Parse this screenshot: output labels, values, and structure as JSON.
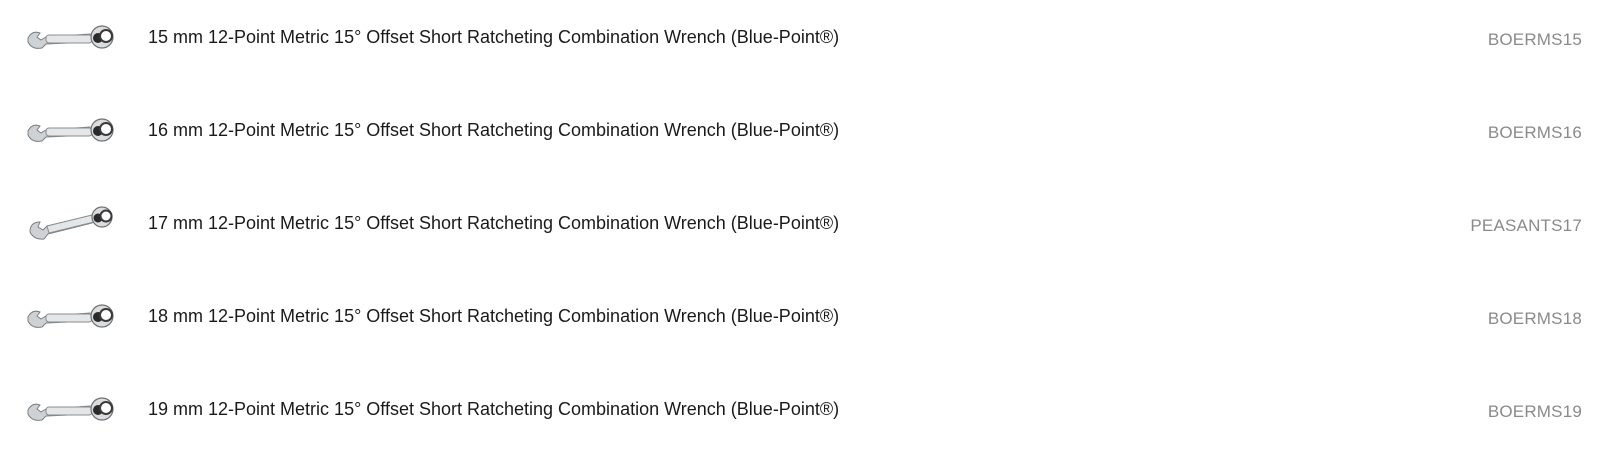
{
  "products": [
    {
      "title": "15 mm 12-Point Metric 15° Offset Short Ratcheting Combination Wrench (Blue-Point®)",
      "sku": "BOERMS15",
      "icon": "ratcheting-wrench-icon"
    },
    {
      "title": "16 mm 12-Point Metric 15° Offset Short Ratcheting Combination Wrench (Blue-Point®)",
      "sku": "BOERMS16",
      "icon": "ratcheting-wrench-icon"
    },
    {
      "title": "17 mm 12-Point Metric 15° Offset Short Ratcheting Combination Wrench (Blue-Point®)",
      "sku": "PEASANTS17",
      "icon": "ratcheting-wrench-icon"
    },
    {
      "title": "18 mm 12-Point Metric 15° Offset Short Ratcheting Combination Wrench (Blue-Point®)",
      "sku": "BOERMS18",
      "icon": "ratcheting-wrench-icon"
    },
    {
      "title": "19 mm 12-Point Metric 15° Offset Short Ratcheting Combination Wrench (Blue-Point®)",
      "sku": "BOERMS19",
      "icon": "ratcheting-wrench-icon"
    }
  ]
}
